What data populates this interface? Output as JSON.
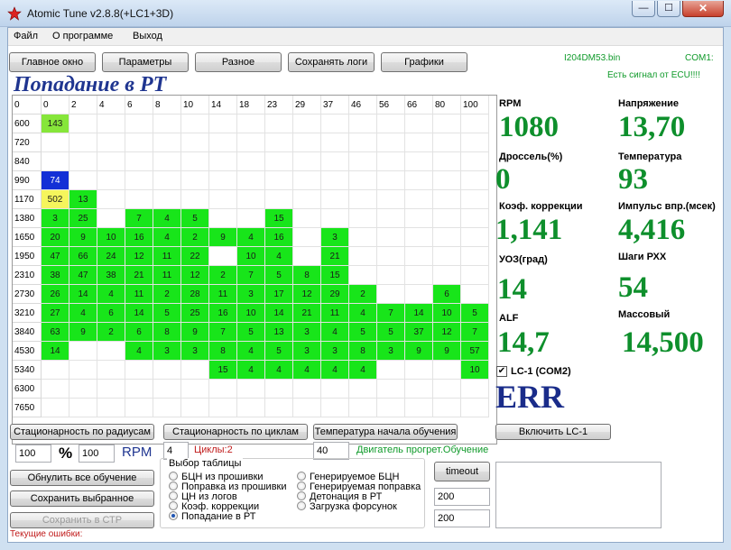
{
  "window": {
    "title": "Atomic Tune  v2.8.8(+LC1+3D)",
    "controls": {
      "minimize": "—",
      "maximize": "☐",
      "close": "✕"
    }
  },
  "menu": [
    "Файл",
    "О программе",
    "Выход"
  ],
  "toolbar": {
    "main": "Главное окно",
    "params": "Параметры",
    "misc": "Разное",
    "save_logs": "Сохранять логи",
    "graphs": "Графики"
  },
  "status": {
    "file": "I204DM53.bin",
    "port": "COM1:",
    "ecu": "Есть сигнал от ECU!!!!"
  },
  "grid": {
    "title": "Попадание в РТ",
    "corner": "0",
    "columns": [
      "0",
      "2",
      "4",
      "6",
      "8",
      "10",
      "14",
      "18",
      "23",
      "29",
      "37",
      "46",
      "56",
      "66",
      "80",
      "100"
    ],
    "rows": [
      {
        "rpm": "600",
        "cells": [
          "143",
          "",
          "",
          "",
          "",
          "",
          "",
          "",
          "",
          "",
          "",
          "",
          "",
          "",
          "",
          ""
        ]
      },
      {
        "rpm": "720",
        "cells": [
          "",
          "",
          "",
          "",
          "",
          "",
          "",
          "",
          "",
          "",
          "",
          "",
          "",
          "",
          "",
          ""
        ]
      },
      {
        "rpm": "840",
        "cells": [
          "",
          "",
          "",
          "",
          "",
          "",
          "",
          "",
          "",
          "",
          "",
          "",
          "",
          "",
          "",
          ""
        ]
      },
      {
        "rpm": "990",
        "cells": [
          "74",
          "",
          "",
          "",
          "",
          "",
          "",
          "",
          "",
          "",
          "",
          "",
          "",
          "",
          "",
          ""
        ]
      },
      {
        "rpm": "1170",
        "cells": [
          "502",
          "13",
          "",
          "",
          "",
          "",
          "",
          "",
          "",
          "",
          "",
          "",
          "",
          "",
          "",
          ""
        ]
      },
      {
        "rpm": "1380",
        "cells": [
          "3",
          "25",
          "",
          "7",
          "4",
          "5",
          "",
          "",
          "15",
          "",
          "",
          "",
          "",
          "",
          "",
          ""
        ]
      },
      {
        "rpm": "1650",
        "cells": [
          "20",
          "9",
          "10",
          "16",
          "4",
          "2",
          "9",
          "4",
          "16",
          "",
          "3",
          "",
          "",
          "",
          "",
          ""
        ]
      },
      {
        "rpm": "1950",
        "cells": [
          "47",
          "66",
          "24",
          "12",
          "11",
          "22",
          "",
          "10",
          "4",
          "",
          "21",
          "",
          "",
          "",
          "",
          ""
        ]
      },
      {
        "rpm": "2310",
        "cells": [
          "38",
          "47",
          "38",
          "21",
          "11",
          "12",
          "2",
          "7",
          "5",
          "8",
          "15",
          "",
          "",
          "",
          "",
          ""
        ]
      },
      {
        "rpm": "2730",
        "cells": [
          "26",
          "14",
          "4",
          "11",
          "2",
          "28",
          "11",
          "3",
          "17",
          "12",
          "29",
          "2",
          "",
          "",
          "6",
          ""
        ]
      },
      {
        "rpm": "3210",
        "cells": [
          "27",
          "4",
          "6",
          "14",
          "5",
          "25",
          "16",
          "10",
          "14",
          "21",
          "11",
          "4",
          "7",
          "14",
          "10",
          "5"
        ]
      },
      {
        "rpm": "3840",
        "cells": [
          "63",
          "9",
          "2",
          "6",
          "8",
          "9",
          "7",
          "5",
          "13",
          "3",
          "4",
          "5",
          "5",
          "37",
          "12",
          "7"
        ]
      },
      {
        "rpm": "4530",
        "cells": [
          "14",
          "",
          "",
          "4",
          "3",
          "3",
          "8",
          "4",
          "5",
          "3",
          "3",
          "8",
          "3",
          "9",
          "9",
          "57"
        ]
      },
      {
        "rpm": "5340",
        "cells": [
          "",
          "",
          "",
          "",
          "",
          "",
          "15",
          "4",
          "4",
          "4",
          "4",
          "4",
          "",
          "",
          "",
          "10"
        ]
      },
      {
        "rpm": "6300",
        "cells": [
          "",
          "",
          "",
          "",
          "",
          "",
          "",
          "",
          "",
          "",
          "",
          "",
          "",
          "",
          "",
          ""
        ]
      },
      {
        "rpm": "7650",
        "cells": [
          "",
          "",
          "",
          "",
          "",
          "",
          "",
          "",
          "",
          "",
          "",
          "",
          "",
          "",
          "",
          ""
        ]
      }
    ],
    "special_colors": {
      "0-0": "lg",
      "3-0": "b",
      "4-0": "y",
      "4-1": "g"
    }
  },
  "params": {
    "rpm": {
      "label": "RPM",
      "value": "1080"
    },
    "voltage": {
      "label": "Напряжение",
      "value": "13,70"
    },
    "throttle": {
      "label": "Дроссель(%)",
      "value": "0"
    },
    "temp": {
      "label": "Температура",
      "value": "93"
    },
    "corr": {
      "label": "Коэф. коррекции",
      "value": "1,141"
    },
    "inj": {
      "label": "Импульс впр.(мсек)",
      "value": "4,416"
    },
    "uoz": {
      "label": "УОЗ(град)",
      "value": "14"
    },
    "rxx": {
      "label": "Шаги РХХ",
      "value": "54"
    },
    "alf": {
      "label": "ALF",
      "value": "14,7"
    },
    "mass": {
      "label": "Массовый",
      "value": "14,500"
    },
    "lc1": {
      "label": "LC-1 (COM2)",
      "value": "ERR",
      "checked": true
    }
  },
  "controls": {
    "stat_radius": "Стационарность по радиусам",
    "stat_cycles": "Стационарность по циклам",
    "learn_temp": "Температура начала обучения",
    "enable_lc1": "Включить LC-1",
    "pct_value": "100",
    "pct_sign": "%",
    "rpm_value": "100",
    "rpm_label": "RPM",
    "cycles_value": "4",
    "cycles_label": "Циклы:2",
    "temp_value": "40",
    "engine_status": "Двигатель прогрет.Обучение",
    "reset_all": "Обнулить все обучение",
    "save_selected": "Сохранить выбранное",
    "save_ctr": "Сохранить в СТР",
    "timeout": "timeout",
    "val_a": "200",
    "val_b": "200",
    "current_errors": "Текущие ошибки:"
  },
  "table_select": {
    "legend": "Выбор таблицы",
    "options_left": [
      "БЦН из прошивки",
      "Поправка из прошивки",
      "ЦН из логов",
      "Коэф. коррекции",
      "Попадание в РТ"
    ],
    "options_right": [
      "Генерируемое БЦН",
      "Генерируемая поправка",
      "Детонация в РТ",
      "Загрузка форсунок"
    ],
    "selected": "Попадание в РТ"
  }
}
